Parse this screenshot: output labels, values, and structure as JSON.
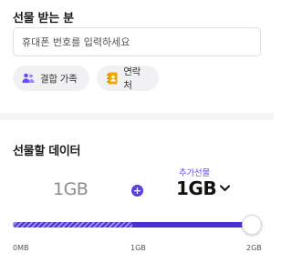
{
  "recipient": {
    "title": "선물 받는 분",
    "phone_placeholder": "휴대폰 번호를 입력하세요",
    "phone_value": "",
    "chips": [
      {
        "label": "결합 가족",
        "icon": "people-icon"
      },
      {
        "label": "연락처",
        "icon": "contacts-book-icon"
      }
    ]
  },
  "gift_data": {
    "title": "선물할 데이터",
    "base_amount": "1GB",
    "extra_label": "추가선물",
    "extra_amount": "1GB",
    "slider": {
      "min_label": "0MB",
      "mid_label": "1GB",
      "max_label": "2GB",
      "base_fraction": 0.5,
      "value_fraction": 1.0
    }
  },
  "colors": {
    "accent": "#4a2fd6",
    "accent_text": "#6a4cf0",
    "chip_bg": "#f1f1f3",
    "divider": "#f4f4f6"
  }
}
